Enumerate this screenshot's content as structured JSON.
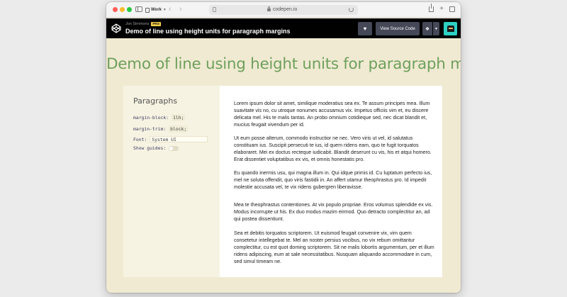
{
  "browser": {
    "tab_group_label": "Work",
    "url": "codepen.io"
  },
  "header": {
    "author": "Jon Simmons",
    "badge": "PRO",
    "title": "Demo of line using height units for paragraph margins",
    "view_source_label": "View Source Code"
  },
  "content": {
    "heading": "Demo of line using height units for paragraph margins",
    "controls": {
      "title": "Paragraphs",
      "margin_block_label": "margin-block:",
      "margin_block_value": "1lh;",
      "margin_trim_label": "margin-trim:",
      "margin_trim_value": "block;",
      "font_label": "Font:",
      "font_value": "System UI",
      "guides_label": "Show guides:"
    },
    "paragraphs": [
      "Lorem ipsum dolor sit amet, similique moderatius sea ex. Te assum principes mea. Illum suavitate vis no, cu utroque nonumes accusamus vix. Impetus officiis vim et, eu discere delicata mel. His te malis tantas. An probo omnium cotidieque sed, nec dicat blandit et, mucius feugait vivendum per id.",
      "Ut eum posse alterum, commodo instructior ne nec. Vero viris ut vel, id salutatus constituam ius. Suscipit persecuti te ius, id quem ridens eam, quo te fugit torquatos elaboraret. Mei ex doctus recteque iudicabit. Blandit deserunt cu vis, his et atqui homero. Erat dissentiet voluptatibus ex vis, et omnis honestatis pro.",
      "Eu quando inermis usu, qui magna illum in. Qui idque primis id. Cu luptatum perfecto ius, mel ne soluta offendit, quo viris fastidii in. An affert utamur theophrastus pro. Id impedit molestie accusata vel, te vix ridens gubergren liberavisse.",
      "Mea te theophrastus contentiones. At vix populo propriae. Eros volumus splendide ex vis. Modus incorrupte ut his. Ex duo modus mazim eirmod. Quo detracto complectitur an, ad qui postea dissentiunt.",
      "Sea et debitis torquatos scriptorem. Ut euismod feugait convenire vix, vim quem consetetur intellegebat te. Mel an noster persius vocibus, no vix rebum omittantur complectitur, cu est quot doming scriptorem. Sit ne malis lobortis argumentum, per et illum ridens adipiscing, eum at sale necessitatibus. Nusquam aliquando accommodare in cum, sed simul timeam ne."
    ]
  },
  "colors": {
    "heading_green": "#6fa05d",
    "page_bg": "#f0ead2",
    "header_bg": "#010101",
    "pro_badge": "#f7cf48"
  }
}
